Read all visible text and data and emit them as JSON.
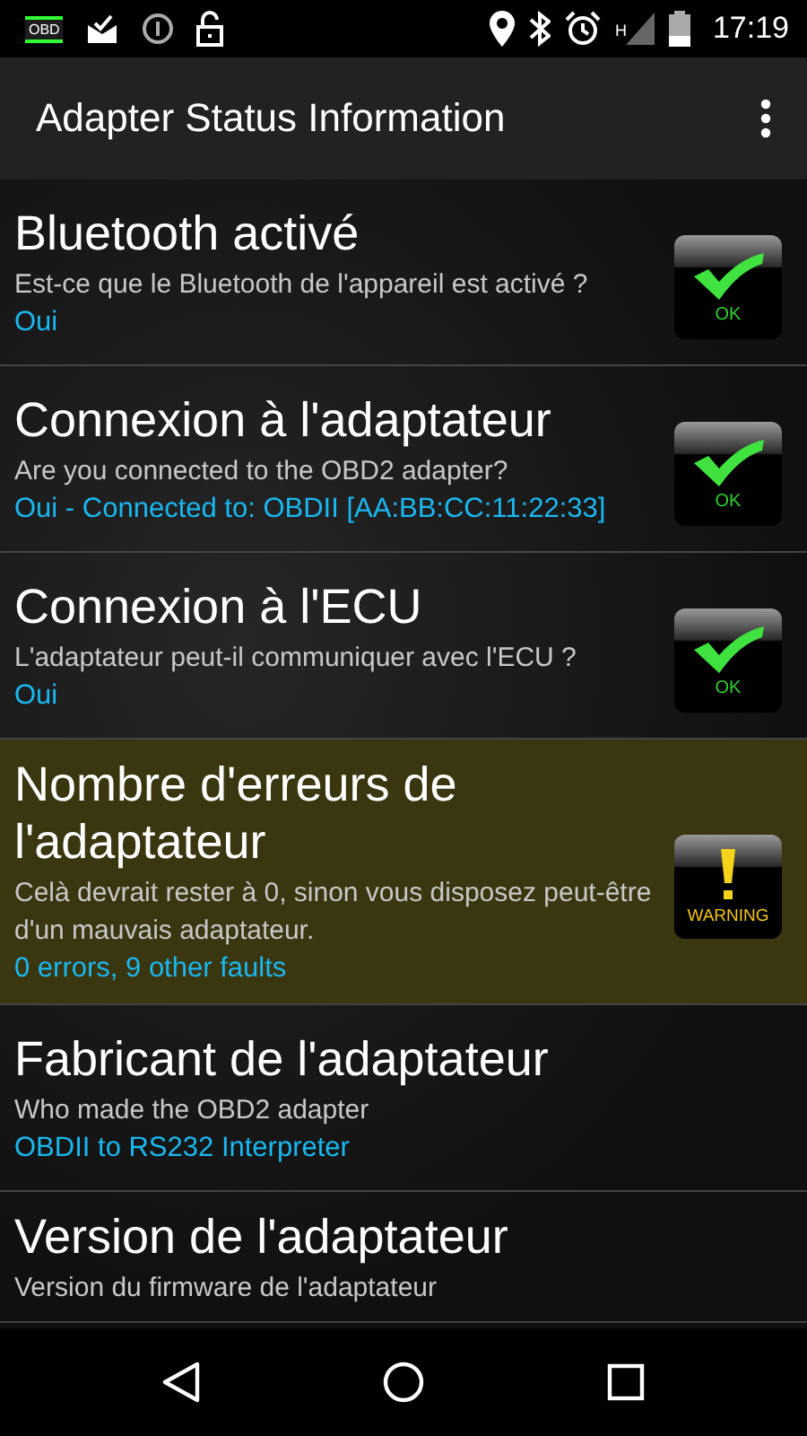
{
  "status_bar": {
    "app_icon_label": "OBD",
    "network_type": "H",
    "time": "17:19"
  },
  "toolbar": {
    "title": "Adapter Status Information"
  },
  "items": [
    {
      "title": "Bluetooth activé",
      "description": "Est-ce que le Bluetooth de l'appareil est activé ?",
      "value": "Oui",
      "highlighted": false,
      "status": {
        "kind": "ok",
        "label": "OK"
      }
    },
    {
      "title": "Connexion à l'adaptateur",
      "description": "Are you connected to the OBD2 adapter?",
      "value": "Oui - Connected to: OBDII [AA:BB:CC:11:22:33]",
      "highlighted": false,
      "status": {
        "kind": "ok",
        "label": "OK"
      }
    },
    {
      "title": "Connexion à l'ECU",
      "description": "L'adaptateur peut-il communiquer avec l'ECU ?",
      "value": "Oui",
      "highlighted": false,
      "status": {
        "kind": "ok",
        "label": "OK"
      }
    },
    {
      "title": "Nombre d'erreurs de l'adaptateur",
      "description": "Celà devrait rester à 0, sinon vous disposez peut-être d'un mauvais adaptateur.",
      "value": "0 errors, 9 other faults",
      "highlighted": true,
      "status": {
        "kind": "warning",
        "label": "WARNING"
      }
    },
    {
      "title": "Fabricant de l'adaptateur",
      "description": "Who made the OBD2 adapter",
      "value": "OBDII to RS232 Interpreter",
      "highlighted": false
    },
    {
      "title": "Version de l'adaptateur",
      "description": "Version du firmware de l'adaptateur",
      "highlighted": false
    }
  ]
}
